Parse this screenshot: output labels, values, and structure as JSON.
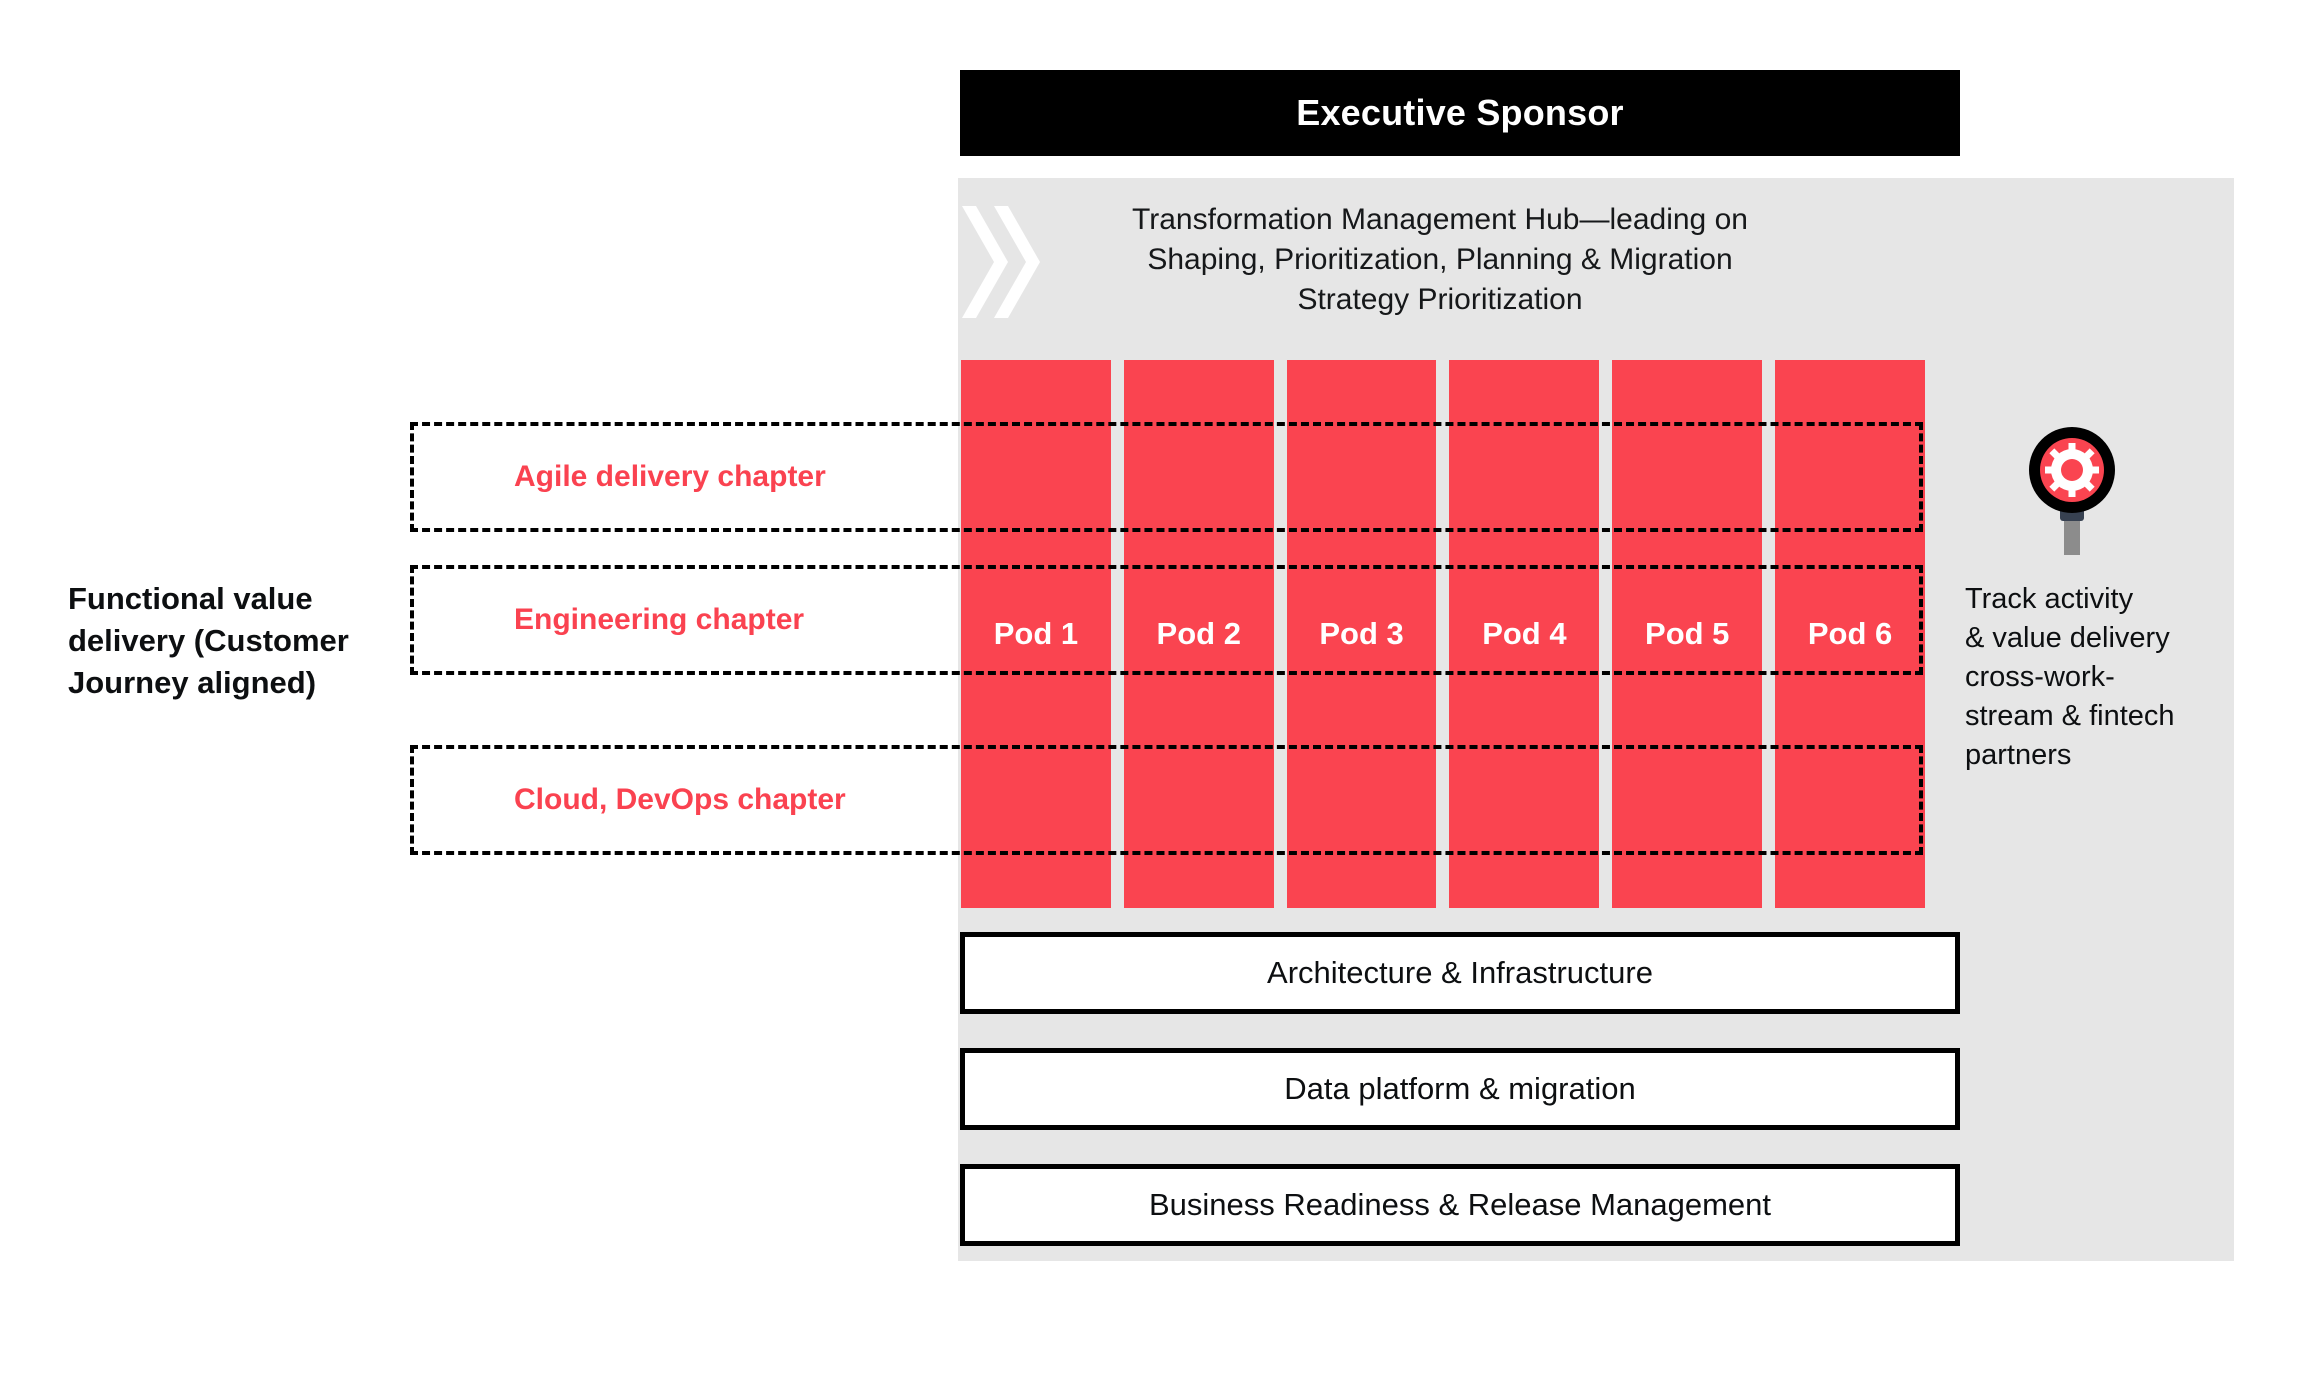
{
  "banner": {
    "title": "Executive Sponsor"
  },
  "hub": {
    "title": "Transformation Management Hub—leading on\nShaping, Prioritization, Planning & Migration\nStrategy Prioritization",
    "chevron_icon": "double-chevron-right-icon"
  },
  "left": {
    "caption": "Functional value\ndelivery (Customer\nJourney aligned)"
  },
  "chapters": [
    {
      "label": "Agile delivery chapter"
    },
    {
      "label": "Engineering chapter"
    },
    {
      "label": "Cloud, DevOps chapter"
    }
  ],
  "pods": [
    {
      "label": "Pod 1"
    },
    {
      "label": "Pod 2"
    },
    {
      "label": "Pod 3"
    },
    {
      "label": "Pod 4"
    },
    {
      "label": "Pod 5"
    },
    {
      "label": "Pod 6"
    }
  ],
  "bottom_bars": [
    {
      "label": "Architecture & Infrastructure"
    },
    {
      "label": "Data platform & migration"
    },
    {
      "label": "Business Readiness & Release Management"
    }
  ],
  "track": {
    "icon": "magnifier-gear-icon",
    "text": "Track activity\n& value delivery\ncross-work-\nstream & fintech\npartners"
  },
  "colors": {
    "accent_red": "#FA4450",
    "panel_gray": "#E6E6E6",
    "banner_black": "#000000",
    "text_dark": "#0D0F11",
    "white": "#FFFFFF"
  }
}
